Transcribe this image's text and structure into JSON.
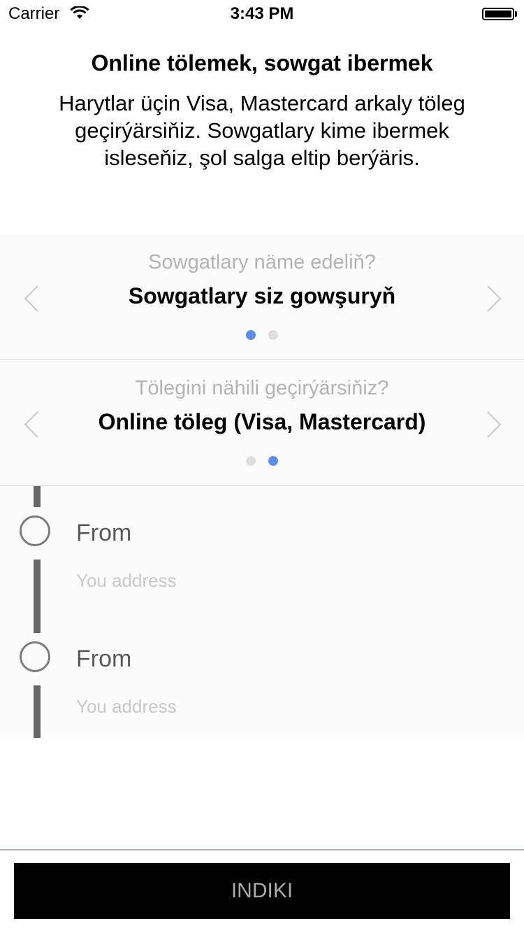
{
  "status_bar": {
    "carrier": "Carrier",
    "time": "3:43 PM",
    "icons": [
      "wifi-icon",
      "battery-icon"
    ]
  },
  "intro": {
    "title": "Online tölemek, sowgat ibermek",
    "description": "Harytlar üçin Visa, Mastercard arkaly töleg geçirýärsiňiz. Sowgatlary kime ibermek isleseňiz, şol salga eltip berýäris."
  },
  "pickers": [
    {
      "question": "Sowgatlary näme edeliň?",
      "answer": "Sowgatlary siz gowşuryň",
      "page_count": 2,
      "active_page": 1
    },
    {
      "question": "Tölegini nähili geçirýärsiňiz?",
      "answer": "Online töleg (Visa, Mastercard)",
      "page_count": 2,
      "active_page": 2
    }
  ],
  "route": {
    "stops": [
      {
        "label": "From",
        "placeholder": "You address"
      },
      {
        "label": "From",
        "placeholder": "You address"
      }
    ]
  },
  "footer": {
    "next_label": "INDIKI"
  },
  "colors": {
    "accent_dot": "#5b8def",
    "inactive_dot": "#dedede",
    "button_bg": "#000000",
    "button_text": "#aaaaaa"
  }
}
